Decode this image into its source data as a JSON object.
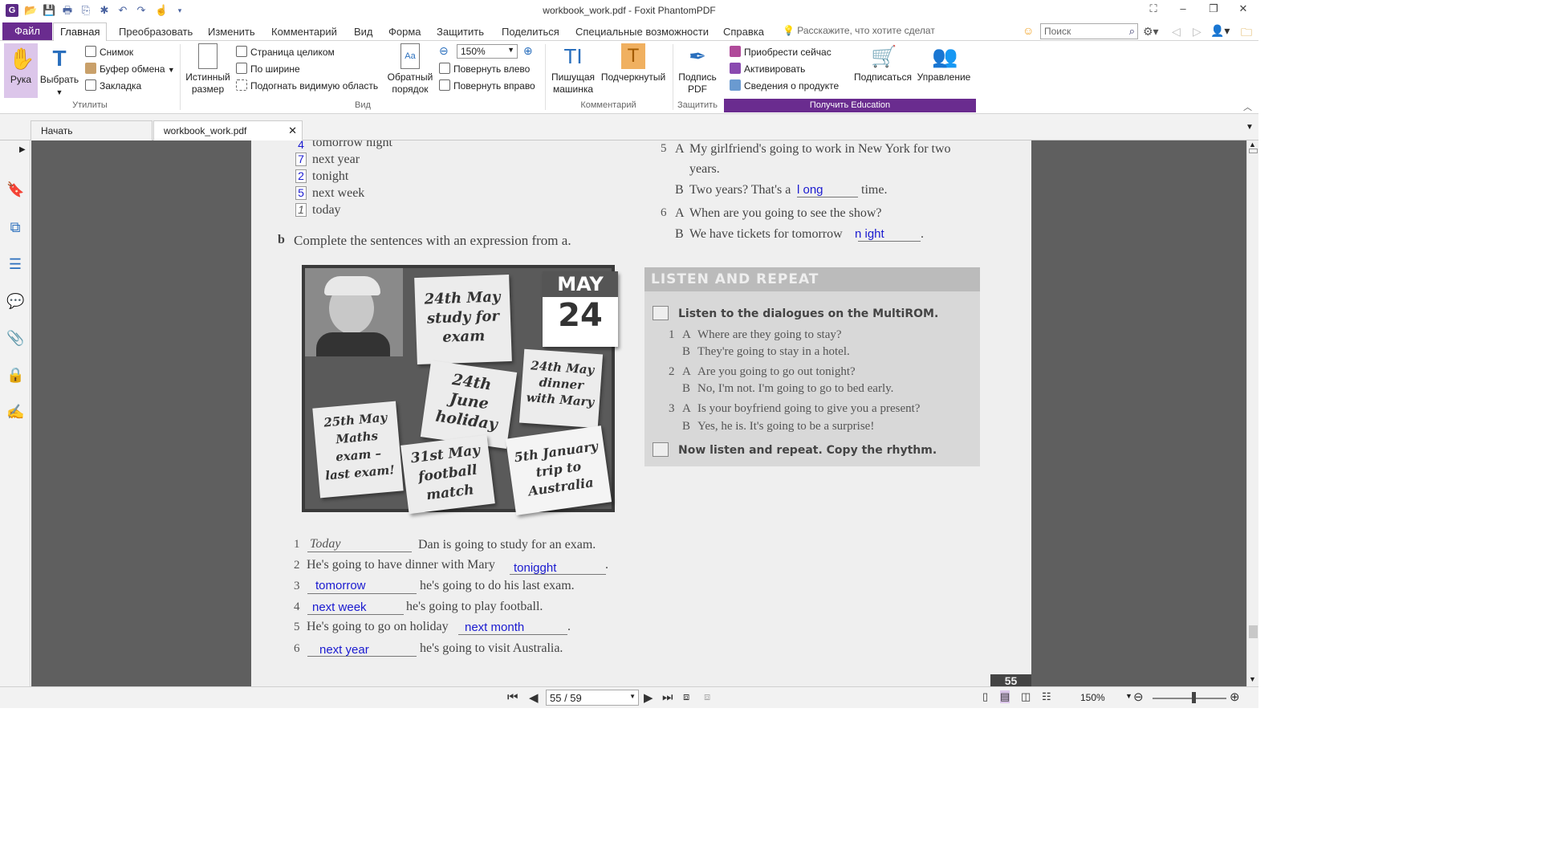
{
  "window": {
    "title": "workbook_work.pdf - Foxit PhantomPDF"
  },
  "menu": {
    "file": "Файл",
    "tabs": [
      "Главная",
      "Преобразовать",
      "Изменить",
      "Комментарий",
      "Вид",
      "Форма",
      "Защитить",
      "Поделиться",
      "Специальные возможности",
      "Справка"
    ],
    "tellme": "Расскажите, что хотите сделат",
    "search_placeholder": "Поиск"
  },
  "ribbon": {
    "hand": "Рука",
    "select": "Выбрать",
    "snapshot": "Снимок",
    "clipboard": "Буфер обмена",
    "bookmark": "Закладка",
    "utilities": "Утилиты",
    "actual_size": [
      "Истинный",
      "размер"
    ],
    "fit_page": "Страница целиком",
    "fit_width": "По ширине",
    "fit_visible": "Подогнать видимую область",
    "reverse_order": [
      "Обратный",
      "порядок"
    ],
    "zoom": "150%",
    "rotate_left": "Повернуть влево",
    "rotate_right": "Повернуть вправо",
    "view_group": "Вид",
    "typewriter": [
      "Пишущая",
      "машинка"
    ],
    "highlight": "Подчеркнутый",
    "comment_group": "Комментарий",
    "sign_pdf": [
      "Подпись",
      "PDF"
    ],
    "protect_group": "Защитить",
    "buy_now": "Приобрести сейчас",
    "activate": "Активировать",
    "product_info": "Сведения о продукте",
    "subscribe": "Подписаться",
    "manage": "Управление",
    "get_education": "Получить Education"
  },
  "doc_tabs": {
    "start": "Начать",
    "file": "workbook_work.pdf"
  },
  "page": {
    "list_a": [
      {
        "n": "4",
        "text": "tomorrow night"
      },
      {
        "n": "7",
        "text": "next year"
      },
      {
        "n": "2",
        "text": "tonight"
      },
      {
        "n": "5",
        "text": "next week"
      },
      {
        "n": "1",
        "text": "today"
      }
    ],
    "b_label": "b",
    "b_text": "Complete the sentences with an expression from a.",
    "b_text_bold": "a",
    "board": {
      "month": "MAY",
      "day": "24",
      "n1": [
        "24th May",
        "study for",
        "exam"
      ],
      "n2": [
        "24th May",
        "dinner",
        "with Mary"
      ],
      "n3": [
        "24th",
        "June",
        "holiday"
      ],
      "n4": [
        "25th May",
        "Maths",
        "exam –",
        "last exam!"
      ],
      "n5": [
        "31st May",
        "football",
        "match"
      ],
      "n6": [
        "5th January",
        "trip to",
        "Australia"
      ]
    },
    "sentences": [
      {
        "n": "1",
        "pre": "",
        "answer": "Today",
        "post": "Dan is going to study for an exam."
      },
      {
        "n": "2",
        "pre": "He's going to have dinner with Mary",
        "answer": "tonigght",
        "post": "."
      },
      {
        "n": "3",
        "pre": "",
        "answer": "tomorrow",
        "post": "he's going to do his last exam."
      },
      {
        "n": "4",
        "pre": "",
        "answer": "next week",
        "post": "he's going to play football."
      },
      {
        "n": "5",
        "pre": "He's going to go on holiday",
        "answer": "next month",
        "post": "."
      },
      {
        "n": "6",
        "pre": "",
        "answer": "next year",
        "post": "he's going to visit Australia."
      }
    ],
    "right": {
      "d5a": "My girlfriend's going to work in New York for two",
      "d5a2": "years.",
      "d5b_pre": "Two years? That's a",
      "d5b_ans": "l ong",
      "d5b_post": "time.",
      "d6a": "When are you going to see the show?",
      "d6b_pre": "We have tickets for tomorrow",
      "d6b_ans": "n  ight",
      "d6b_post": "."
    },
    "listen": {
      "header": "LISTEN AND REPEAT",
      "instr1": "Listen to the dialogues on the MultiROM.",
      "lines": [
        {
          "n": "1",
          "s": "A",
          "t": "Where are they going to stay?"
        },
        {
          "n": "",
          "s": "B",
          "t": "They're going to stay in a hotel."
        },
        {
          "n": "2",
          "s": "A",
          "t": "Are you going to go out tonight?"
        },
        {
          "n": "",
          "s": "B",
          "t": "No, I'm not. I'm going to go to bed early."
        },
        {
          "n": "3",
          "s": "A",
          "t": "Is your boyfriend going to give you a present?"
        },
        {
          "n": "",
          "s": "B",
          "t": "Yes, he is. It's going to be a surprise!"
        }
      ],
      "instr2": "Now listen and repeat. Copy the rhythm."
    },
    "page_number": "55"
  },
  "status": {
    "page": "55 / 59",
    "zoom": "150%"
  }
}
